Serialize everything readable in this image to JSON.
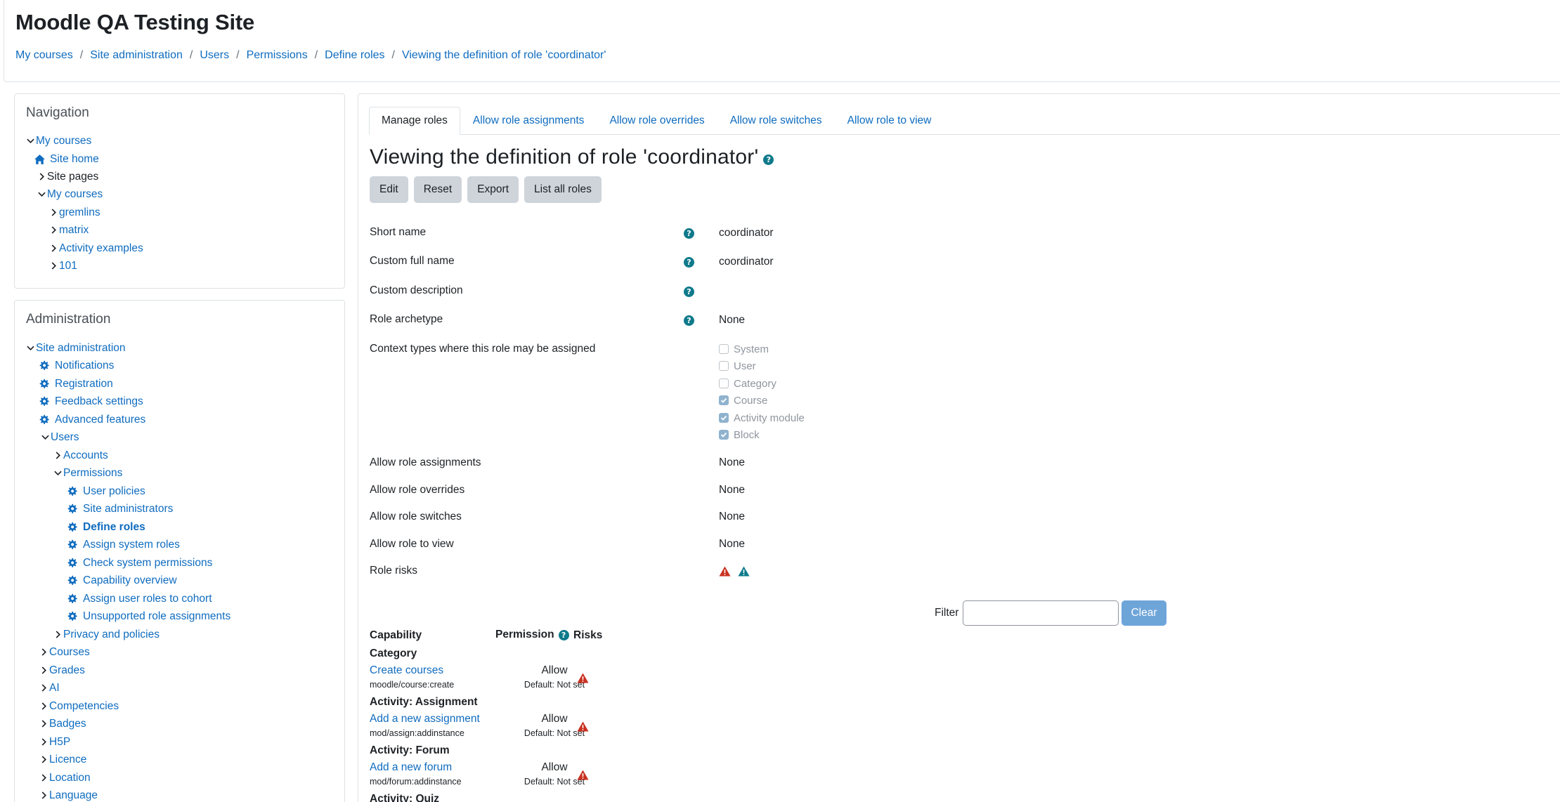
{
  "site": {
    "title": "Moodle QA Testing Site"
  },
  "breadcrumb": [
    "My courses",
    "Site administration",
    "Users",
    "Permissions",
    "Define roles",
    "Viewing the definition of role 'coordinator'"
  ],
  "navigation": {
    "title": "Navigation",
    "my_courses": "My courses",
    "site_home": "Site home",
    "site_pages": "Site pages",
    "my_courses_sub": "My courses",
    "courses": [
      "gremlins",
      "matrix",
      "Activity examples",
      "101"
    ]
  },
  "administration": {
    "title": "Administration",
    "site_admin": "Site administration",
    "notifications": "Notifications",
    "registration": "Registration",
    "feedback_settings": "Feedback settings",
    "advanced_features": "Advanced features",
    "users": "Users",
    "accounts": "Accounts",
    "permissions": "Permissions",
    "permission_items": [
      "User policies",
      "Site administrators",
      "Define roles",
      "Assign system roles",
      "Check system permissions",
      "Capability overview",
      "Assign user roles to cohort",
      "Unsupported role assignments"
    ],
    "privacy": "Privacy and policies",
    "sections": [
      "Courses",
      "Grades",
      "AI",
      "Competencies",
      "Badges",
      "H5P",
      "Licence",
      "Location",
      "Language"
    ]
  },
  "tabs": [
    "Manage roles",
    "Allow role assignments",
    "Allow role overrides",
    "Allow role switches",
    "Allow role to view"
  ],
  "heading": "Viewing the definition of role 'coordinator'",
  "buttons": {
    "edit": "Edit",
    "reset": "Reset",
    "export": "Export",
    "list": "List all roles"
  },
  "definition": {
    "short_name_label": "Short name",
    "short_name": "coordinator",
    "full_name_label": "Custom full name",
    "full_name": "coordinator",
    "description_label": "Custom description",
    "archetype_label": "Role archetype",
    "archetype": "None",
    "context_label": "Context types where this role may be assigned",
    "contexts": [
      {
        "label": "System",
        "checked": false
      },
      {
        "label": "User",
        "checked": false
      },
      {
        "label": "Category",
        "checked": false
      },
      {
        "label": "Course",
        "checked": true
      },
      {
        "label": "Activity module",
        "checked": true
      },
      {
        "label": "Block",
        "checked": true
      }
    ],
    "assign_label": "Allow role assignments",
    "assign": "None",
    "override_label": "Allow role overrides",
    "override": "None",
    "switch_label": "Allow role switches",
    "switch": "None",
    "view_label": "Allow role to view",
    "view": "None",
    "risks_label": "Role risks"
  },
  "filter": {
    "label": "Filter",
    "value": "",
    "clear": "Clear"
  },
  "capabilities": {
    "header_capability": "Capability",
    "header_permission": "Permission",
    "header_risks": "Risks",
    "groups": [
      {
        "title": "Category",
        "name": "Create courses",
        "code": "moodle/course:create",
        "permission": "Allow",
        "default": "Default: Not set"
      },
      {
        "title": "Activity: Assignment",
        "name": "Add a new assignment",
        "code": "mod/assign:addinstance",
        "permission": "Allow",
        "default": "Default: Not set"
      },
      {
        "title": "Activity: Forum",
        "name": "Add a new forum",
        "code": "mod/forum:addinstance",
        "permission": "Allow",
        "default": "Default: Not set"
      }
    ],
    "next_group": "Activity: Quiz"
  },
  "colors": {
    "link": "#0f6cbf",
    "help": "#0f7a8b",
    "risk_red": "#ca3120",
    "risk_teal": "#0f7a8b"
  }
}
